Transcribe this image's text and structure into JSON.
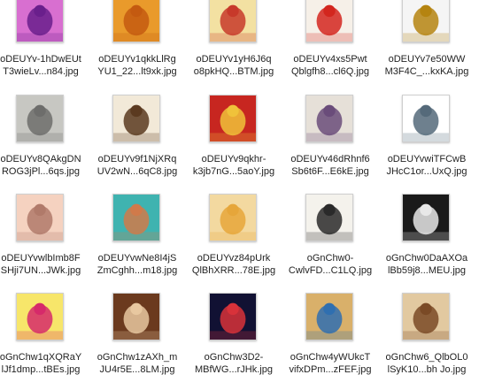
{
  "files": [
    {
      "line1": "oDEUYv-1hDwEUt",
      "line2": "T3wieLv...n84.jpg",
      "thumb": "dvd-cover-purple-thumbnail",
      "colors": [
        "#d86fd0",
        "#6a1f8c"
      ]
    },
    {
      "line1": "oDEUYv1qkkLlRg",
      "line2": "YU1_22...lt9xk.jpg",
      "thumb": "golden-buddha-thumbnail",
      "colors": [
        "#e99a2b",
        "#c45a10"
      ]
    },
    {
      "line1": "oDEUYv1yH6J6q",
      "line2": "o8pkHQ...BTM.jpg",
      "thumb": "integrity-calligraphy-card-thumbnail",
      "colors": [
        "#f3e1a2",
        "#c7392a"
      ]
    },
    {
      "line1": "oDEUYv4xs5Pwt",
      "line2": "Qblgfh8...cl6Q.jpg",
      "thumb": "red-greeting-graphic-thumbnail",
      "colors": [
        "#f6f0e8",
        "#d3261e"
      ]
    },
    {
      "line1": "oDEUYv7e50WW",
      "line2": "M3F4C_...kxKA.jpg",
      "thumb": "golden-statue-thumbnail",
      "colors": [
        "#f5f5f5",
        "#b58410"
      ]
    },
    {
      "line1": "oDEUYv8QAkgDN",
      "line2": "ROG3jPl...6qs.jpg",
      "thumb": "gray-calligraphy-thumbnail",
      "colors": [
        "#c7c7c2",
        "#6d6d6b"
      ]
    },
    {
      "line1": "oDEUYv9f1NjXRq",
      "line2": "UV2wN...6qC8.jpg",
      "thumb": "fu-character-carving-thumbnail",
      "colors": [
        "#f2e9d8",
        "#5b3a20"
      ]
    },
    {
      "line1": "oDEUYv9qkhr-",
      "line2": "k3jb7nG...5aoY.jpg",
      "thumb": "shou-longevity-medallion-thumbnail",
      "colors": [
        "#c72620",
        "#f0c23a"
      ]
    },
    {
      "line1": "oDEUYv46dRhnf6",
      "line2": "Sb6t6F...E6kE.jpg",
      "thumb": "coffee-cup-thumbnail",
      "colors": [
        "#e6e0d8",
        "#6a4c7a"
      ]
    },
    {
      "line1": "oDEUYvwiTFCwB",
      "line2": "JHcC1or...UxQ.jpg",
      "thumb": "character-circle-thumbnail",
      "colors": [
        "#ffffff",
        "#556a7a"
      ]
    },
    {
      "line1": "oDEUYvwlbImb8F",
      "line2": "SHji7UN...JWk.jpg",
      "thumb": "baby-photo-thumbnail",
      "colors": [
        "#f5d2c0",
        "#b07a6a"
      ]
    },
    {
      "line1": "oDEUYvwNe8I4jS",
      "line2": "ZmCghh...m18.jpg",
      "thumb": "twins-teal-background-thumbnail",
      "colors": [
        "#3fb3b0",
        "#d07a4a"
      ]
    },
    {
      "line1": "oDEUYvz84pUrk",
      "line2": "QlBhXRR...78E.jpg",
      "thumb": "guanyin-statue-thumbnail",
      "colors": [
        "#f3d9a0",
        "#e6a63a"
      ]
    },
    {
      "line1": "oGnChw0-",
      "line2": "CwlvFD...C1LQ.jpg",
      "thumb": "brush-calligraphy-thumbnail",
      "colors": [
        "#f4f2ec",
        "#2a2a2a"
      ]
    },
    {
      "line1": "oGnChw0DaAXOa",
      "line2": "lBb59j8...MEU.jpg",
      "thumb": "trident-logo-black-thumbnail",
      "colors": [
        "#1a1a1a",
        "#e8e8e8"
      ]
    },
    {
      "line1": "oGnChw1qXQRaY",
      "line2": "lJf1dmp...tBEs.jpg",
      "thumb": "yellow-flower-greeting-thumbnail",
      "colors": [
        "#f7e66a",
        "#d62a6a"
      ]
    },
    {
      "line1": "oGnChw1zAXh_m",
      "line2": "JU4r5E...8LM.jpg",
      "thumb": "carved-character-brown-thumbnail",
      "colors": [
        "#6b3a1e",
        "#e8c8a0"
      ]
    },
    {
      "line1": "oGnChw3D2-",
      "line2": "MBfWG...rJHk.jpg",
      "thumb": "rose-dark-background-thumbnail",
      "colors": [
        "#111133",
        "#d8323a"
      ]
    },
    {
      "line1": "oGnChw4yWUkcT",
      "line2": "vifxDPm...zFEF.jpg",
      "thumb": "colorful-buddha-thumbnail",
      "colors": [
        "#d9b06a",
        "#2f6fb0"
      ]
    },
    {
      "line1": "oGnChw6_QlbOL0",
      "line2": "lSyK10...bh Jo.jpg",
      "thumb": "wooden-sign-calligraphy-thumbnail",
      "colors": [
        "#e2c9a0",
        "#7a4a26"
      ]
    }
  ]
}
